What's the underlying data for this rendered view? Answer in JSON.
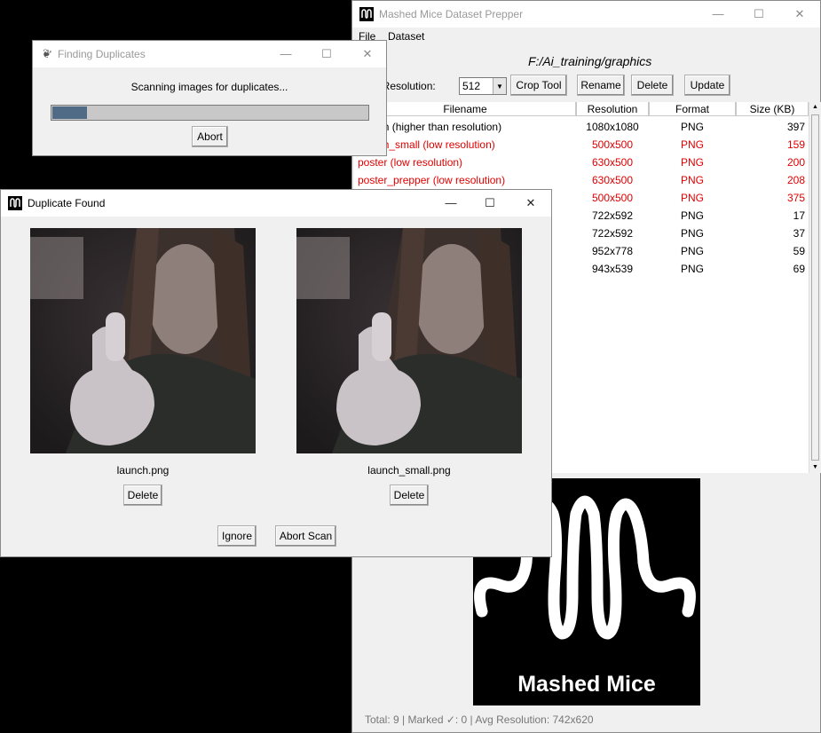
{
  "main_window": {
    "title": "Mashed Mice Dataset Prepper",
    "controls": {
      "minimize": "—",
      "maximize": "☐",
      "close": "✕"
    },
    "menu": [
      "File",
      "Dataset"
    ],
    "path": "F:/Ai_training/graphics",
    "toolbar": {
      "resolution_label": "Target Resolution:",
      "resolution_value": "512",
      "crop_label": "Crop Tool",
      "rename_label": "Rename",
      "delete_label": "Delete",
      "update_label": "Update"
    },
    "table": {
      "columns": [
        "Filename",
        "Resolution",
        "Format",
        "Size (KB)"
      ],
      "rows": [
        {
          "filename": "launch (higher than resolution)",
          "resolution": "1080x1080",
          "format": "PNG",
          "size": "397",
          "color": "#000000"
        },
        {
          "filename": "launch_small (low resolution)",
          "resolution": "500x500",
          "format": "PNG",
          "size": "159",
          "color": "#e00000"
        },
        {
          "filename": "poster (low resolution)",
          "resolution": "630x500",
          "format": "PNG",
          "size": "200",
          "color": "#e00000"
        },
        {
          "filename": "poster_prepper (low resolution)",
          "resolution": "630x500",
          "format": "PNG",
          "size": "208",
          "color": "#e00000"
        },
        {
          "filename": "",
          "resolution": "500x500",
          "format": "PNG",
          "size": "375",
          "color": "#e00000"
        },
        {
          "filename": "",
          "resolution": "722x592",
          "format": "PNG",
          "size": "17",
          "color": "#000000"
        },
        {
          "filename": "",
          "resolution": "722x592",
          "format": "PNG",
          "size": "37",
          "color": "#000000"
        },
        {
          "filename": "",
          "resolution": "952x778",
          "format": "PNG",
          "size": "59",
          "color": "#000000"
        },
        {
          "filename": "",
          "resolution": "943x539",
          "format": "PNG",
          "size": "69",
          "color": "#000000"
        }
      ]
    },
    "preview_logo_text": "Mashed Mice",
    "status": "Total: 9 | Marked ✓: 0 | Avg Resolution: 742x620"
  },
  "finding_dialog": {
    "title": "Finding Duplicates",
    "message": "Scanning images for duplicates...",
    "progress": 0.11,
    "abort_label": "Abort"
  },
  "duplicate_dialog": {
    "title": "Duplicate Found",
    "left_filename": "launch.png",
    "right_filename": "launch_small.png",
    "delete_label": "Delete",
    "ignore_label": "Ignore",
    "abort_scan_label": "Abort Scan"
  }
}
